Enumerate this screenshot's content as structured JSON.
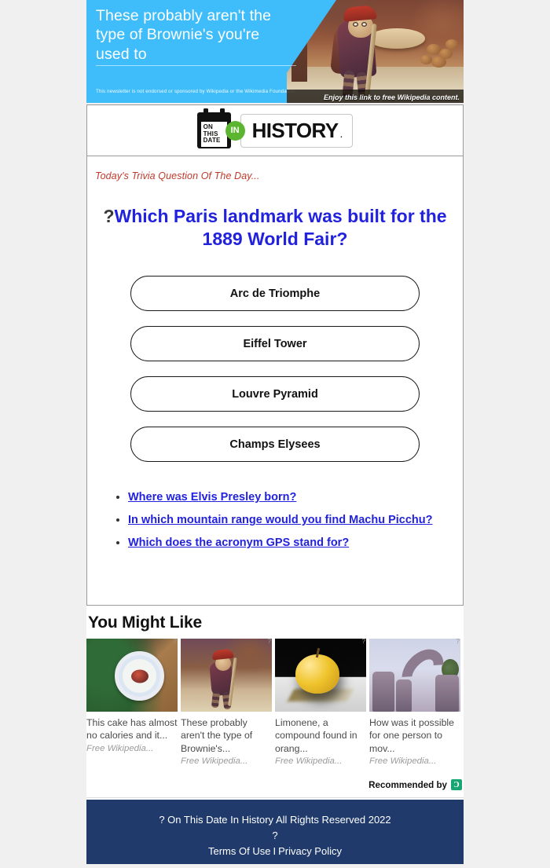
{
  "ad_banner": {
    "headline": "These probably aren't the type of Brownie's you're used to",
    "disclaimer": "This newsletter is not endorsed or sponsored by Wikipedia or the Wikimedia Foundation.",
    "caption": "Enjoy this link to free Wikipedia content.",
    "background_color": "#3fbdfb",
    "image_alt": "brownie-goblin-illustration"
  },
  "logo": {
    "calendar_line1": "ON",
    "calendar_line2": "THIS",
    "calendar_line3": "DATE",
    "in_badge": "IN",
    "brand": "HISTORY",
    "brand_dot": ".",
    "badge_color": "#5cb531"
  },
  "trivia": {
    "label": "Today's Trivia Question Of The Day...",
    "question_mark": "?",
    "question": "Which Paris landmark was built for the 1889 World Fair?",
    "question_color": "#2222dd",
    "answers": [
      "Arc de Triomphe",
      "Eiffel Tower",
      "Louvre Pyramid",
      "Champs Elysees"
    ],
    "more_links": [
      "Where was Elvis Presley born?",
      "In which mountain range would you find Machu Picchu?",
      "Which does the acronym GPS stand for?"
    ]
  },
  "you_might_like": {
    "title": "You Might Like",
    "badge_marker": "?",
    "cards": [
      {
        "title": "This cake has almost no calories and it...",
        "source": "Free Wikipedia...",
        "image_alt": "plate-of-food-on-wood"
      },
      {
        "title": "These probably aren't the type of Brownie's...",
        "source": "Free Wikipedia...",
        "image_alt": "brownie-goblin-illustration"
      },
      {
        "title": "Limonene, a compound found in orang...",
        "source": "Free Wikipedia...",
        "image_alt": "yellow-apple-on-black"
      },
      {
        "title": "How was it possible for one person to mov...",
        "source": "Free Wikipedia...",
        "image_alt": "stone-monoliths"
      }
    ],
    "recommended_by": "Recommended by",
    "recommended_mark": "Ɔ",
    "recommended_mark_color": "#17a673"
  },
  "footer": {
    "copyright": "? On This Date In History All Rights Reserved 2022",
    "middle_mark": "?",
    "terms": "Terms Of Use",
    "separator": "I",
    "privacy": "Privacy Policy",
    "background_color": "#1f3a6b"
  }
}
